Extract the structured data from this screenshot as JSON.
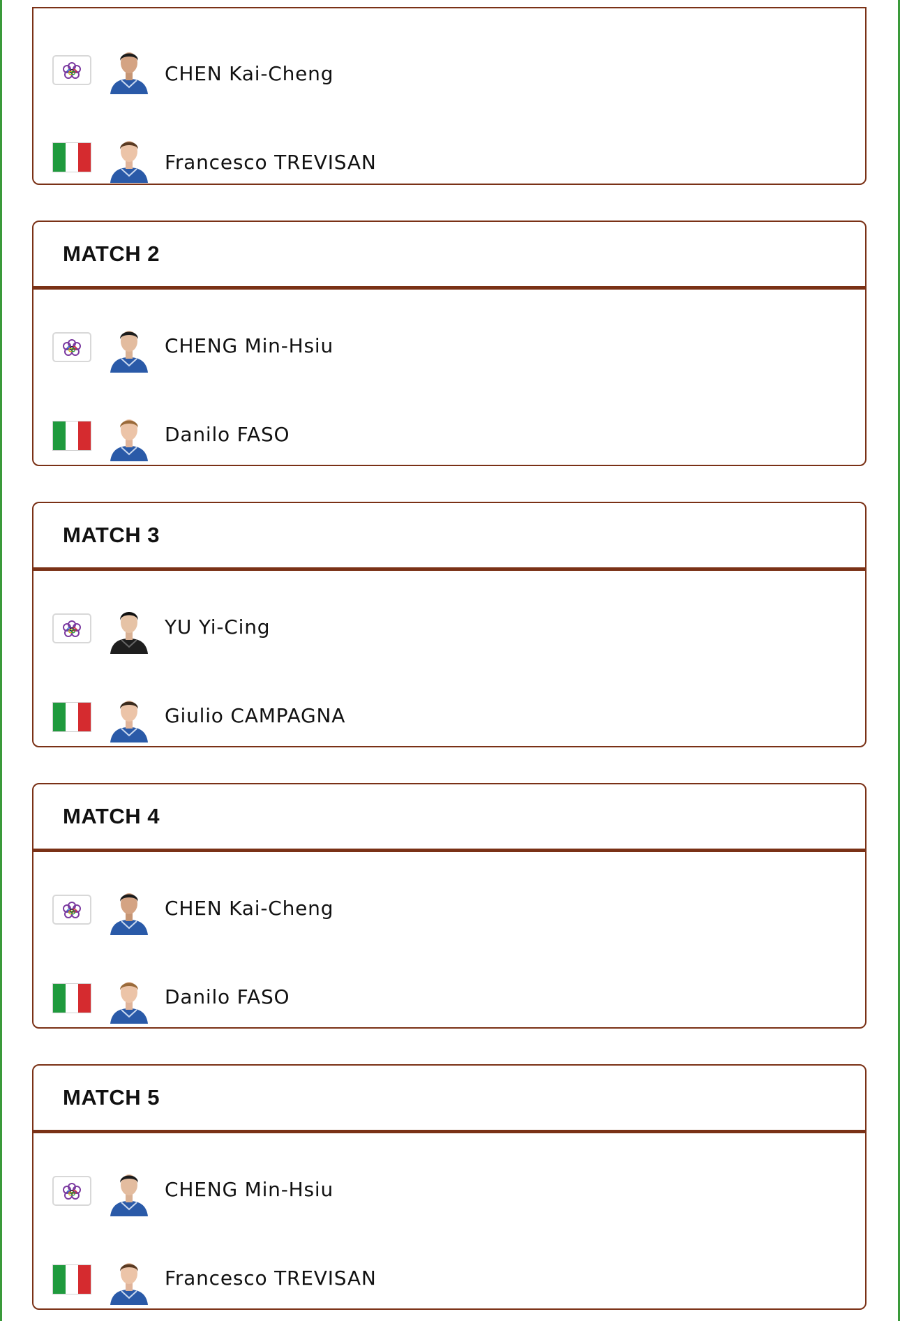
{
  "colors": {
    "card_border": "#7a3116",
    "page_edge": "#3a9a3a",
    "italy_green": "#1f9a3d",
    "italy_red": "#d52b2f",
    "tpe_blossom": "#7b3aa0"
  },
  "matches": [
    {
      "title": "",
      "players": [
        {
          "name": "CHEN Kai-Cheng",
          "flag_icon": "chinese-taipei-flag-icon"
        },
        {
          "name": "Francesco TREVISAN",
          "flag_icon": "italy-flag-icon"
        }
      ]
    },
    {
      "title": "MATCH 2",
      "players": [
        {
          "name": "CHENG Min-Hsiu",
          "flag_icon": "chinese-taipei-flag-icon"
        },
        {
          "name": "Danilo FASO",
          "flag_icon": "italy-flag-icon"
        }
      ]
    },
    {
      "title": "MATCH 3",
      "players": [
        {
          "name": "YU Yi-Cing",
          "flag_icon": "chinese-taipei-flag-icon"
        },
        {
          "name": "Giulio CAMPAGNA",
          "flag_icon": "italy-flag-icon"
        }
      ]
    },
    {
      "title": "MATCH 4",
      "players": [
        {
          "name": "CHEN Kai-Cheng",
          "flag_icon": "chinese-taipei-flag-icon"
        },
        {
          "name": "Danilo FASO",
          "flag_icon": "italy-flag-icon"
        }
      ]
    },
    {
      "title": "MATCH 5",
      "players": [
        {
          "name": "CHENG Min-Hsiu",
          "flag_icon": "chinese-taipei-flag-icon"
        },
        {
          "name": "Francesco TREVISAN",
          "flag_icon": "italy-flag-icon"
        }
      ]
    }
  ]
}
